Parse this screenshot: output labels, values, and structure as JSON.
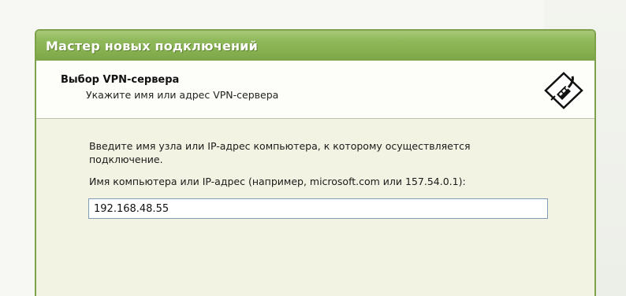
{
  "window": {
    "title": "Мастер новых подключений"
  },
  "header": {
    "title": "Выбор VPN-сервера",
    "subtitle": "Укажите имя или адрес VPN-сервера",
    "icon": "network-plug-icon"
  },
  "form": {
    "instruction": "Введите имя узла или IP-адрес компьютера, к  которому осуществляется подключение.",
    "field_label": "Имя компьютера или IP-адрес (например, microsoft.com или 157.54.0.1):",
    "host_value": "192.168.48.55"
  },
  "colors": {
    "titlebar": "#8fb85a",
    "border": "#7da24a",
    "content_bg": "#f3f3e3",
    "input_border": "#7f9db9"
  }
}
